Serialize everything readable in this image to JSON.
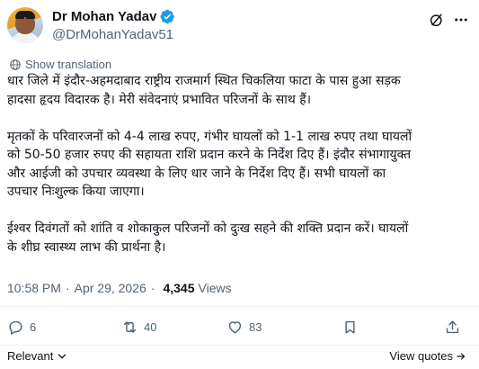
{
  "author": {
    "display_name": "Dr Mohan Yadav",
    "handle": "@DrMohanYadav51",
    "verified_color": "#1d9bf0"
  },
  "header_icons": [
    "grok-icon",
    "more-options-icon"
  ],
  "translation": {
    "label": "Show translation",
    "icon": "globe-icon"
  },
  "post": {
    "paragraphs": [
      "धार जिले में इंदौर-अहमदाबाद राष्ट्रीय राजमार्ग स्थित चिकलिया फाटा के पास हुआ सड़क\nहादसा हृदय विदारक है। मेरी संवेदनाएं प्रभावित परिजनों के साथ हैं।",
      "मृतकों के परिवारजनों को 4-4 लाख रुपए, गंभीर घायलों को 1-1 लाख रुपए तथा घायलों\nको 50-50 हजार रुपए की सहायता राशि प्रदान करने के निर्देश दिए हैं। इंदौर संभागायुक्त\nऔर आईजी को उपचार व्यवस्था के लिए धार जाने के निर्देश दिए हैं। सभी घायलों का\nउपचार निःशुल्क किया जाएगा।",
      "ईश्वर दिवंगतों को शांति व शोकाकुल परिजनों को दुःख सहने की शक्ति प्रदान करें। घायलों\nके शीघ्र स्वास्थ्य लाभ की प्रार्थना है।"
    ]
  },
  "meta": {
    "time": "10:58 PM",
    "separator": "·",
    "date": "Apr 29, 2026",
    "views_count": "4,345",
    "views_label": "Views"
  },
  "actions": {
    "replies": "6",
    "reposts": "40",
    "likes": "83",
    "bookmarks": ""
  },
  "footer": {
    "sort_label": "Relevant",
    "view_quotes_label": "View quotes"
  }
}
